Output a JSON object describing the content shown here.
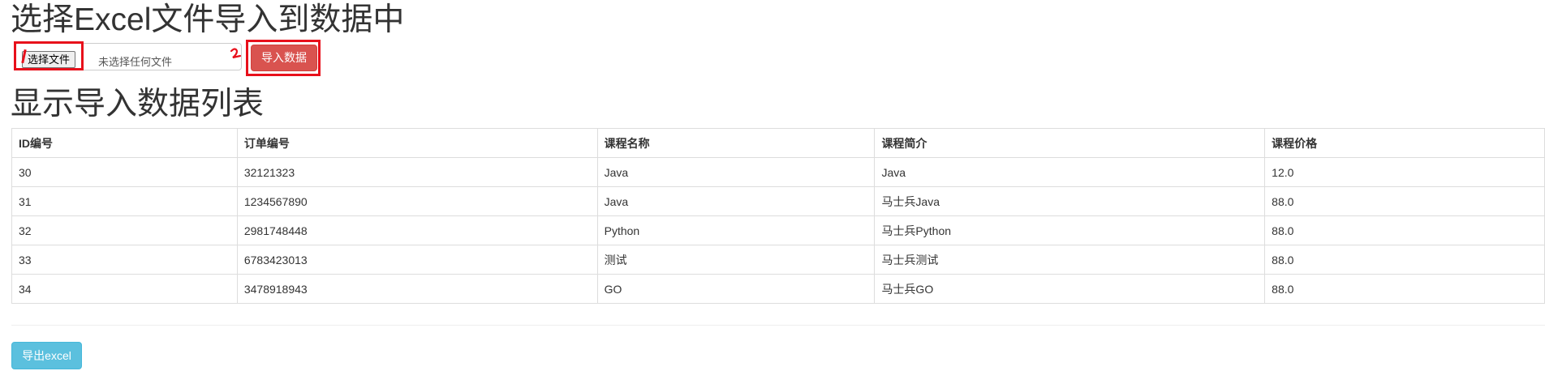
{
  "upload_section": {
    "title": "选择Excel文件导入到数据中",
    "choose_file_label": "选择文件",
    "file_status": "未选择任何文件",
    "import_button": "导入数据"
  },
  "list_section": {
    "title": "显示导入数据列表",
    "columns": [
      "ID编号",
      "订单编号",
      "课程名称",
      "课程简介",
      "课程价格"
    ],
    "rows": [
      [
        "30",
        "32121323",
        "Java",
        "Java",
        "12.0"
      ],
      [
        "31",
        "1234567890",
        "Java",
        "马士兵Java",
        "88.0"
      ],
      [
        "32",
        "2981748448",
        "Python",
        "马士兵Python",
        "88.0"
      ],
      [
        "33",
        "6783423013",
        "测试",
        "马士兵测试",
        "88.0"
      ],
      [
        "34",
        "3478918943",
        "GO",
        "马士兵GO",
        "88.0"
      ]
    ]
  },
  "export_button": "导出excel",
  "colors": {
    "danger": "#d9534f",
    "info": "#5bc0de",
    "annotation": "#e8101b"
  }
}
